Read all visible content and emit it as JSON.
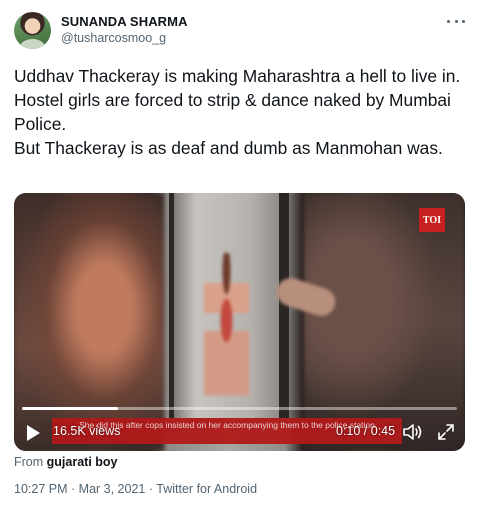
{
  "author": {
    "name": "SUNANDA SHARMA",
    "handle": "@tusharcosmoo_g"
  },
  "tweet": {
    "paragraphs": [
      "Uddhav Thackeray is making Maharashtra a hell to live in.",
      "Hostel girls are forced to strip & dance naked by Mumbai Police.",
      "But Thackeray is as deaf and dumb as Manmohan was."
    ]
  },
  "video": {
    "channel_logo": "TOI",
    "caption": "She did this after cops insisted on her accompanying them to the police station",
    "views": "16.5K views",
    "time": "0:10 / 0:45",
    "progress_fraction": 0.22,
    "icons": {
      "play": "play-icon",
      "volume": "volume-icon",
      "fullscreen": "fullscreen-icon"
    }
  },
  "source": {
    "prefix": "From",
    "name": "gujarati boy"
  },
  "meta": {
    "time": "10:27 PM",
    "date": "Mar 3, 2021",
    "client": "Twitter for Android",
    "separator": "·"
  },
  "colors": {
    "text_primary": "#0f1419",
    "text_secondary": "#536471",
    "caption_bar": "#b11a1a",
    "toi_red": "#c8201f"
  }
}
